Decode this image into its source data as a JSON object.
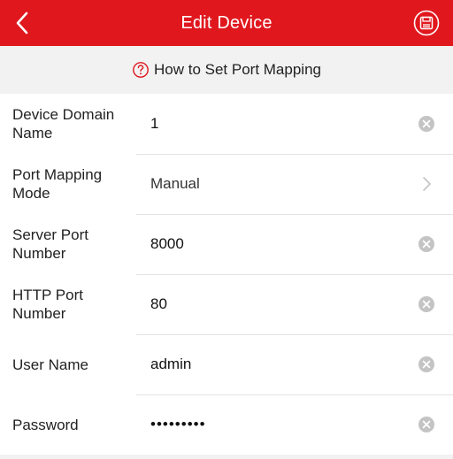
{
  "header": {
    "title": "Edit Device",
    "bg_color": "#e0181e",
    "back_icon": "chevron-left-icon",
    "save_icon": "save-icon"
  },
  "help": {
    "text": "How to Set Port Mapping",
    "icon": "question-circle-icon",
    "icon_color": "#e0181e"
  },
  "form": {
    "domain": {
      "label": "Device Domain Name",
      "value": "1"
    },
    "port_mode": {
      "label": "Port Mapping Mode",
      "value": "Manual"
    },
    "server_port": {
      "label": "Server Port Number",
      "value": "8000"
    },
    "http_port": {
      "label": "HTTP Port Number",
      "value": "80"
    },
    "username": {
      "label": "User Name",
      "value": "admin"
    },
    "password": {
      "label": "Password",
      "value": "•••••••••"
    }
  }
}
